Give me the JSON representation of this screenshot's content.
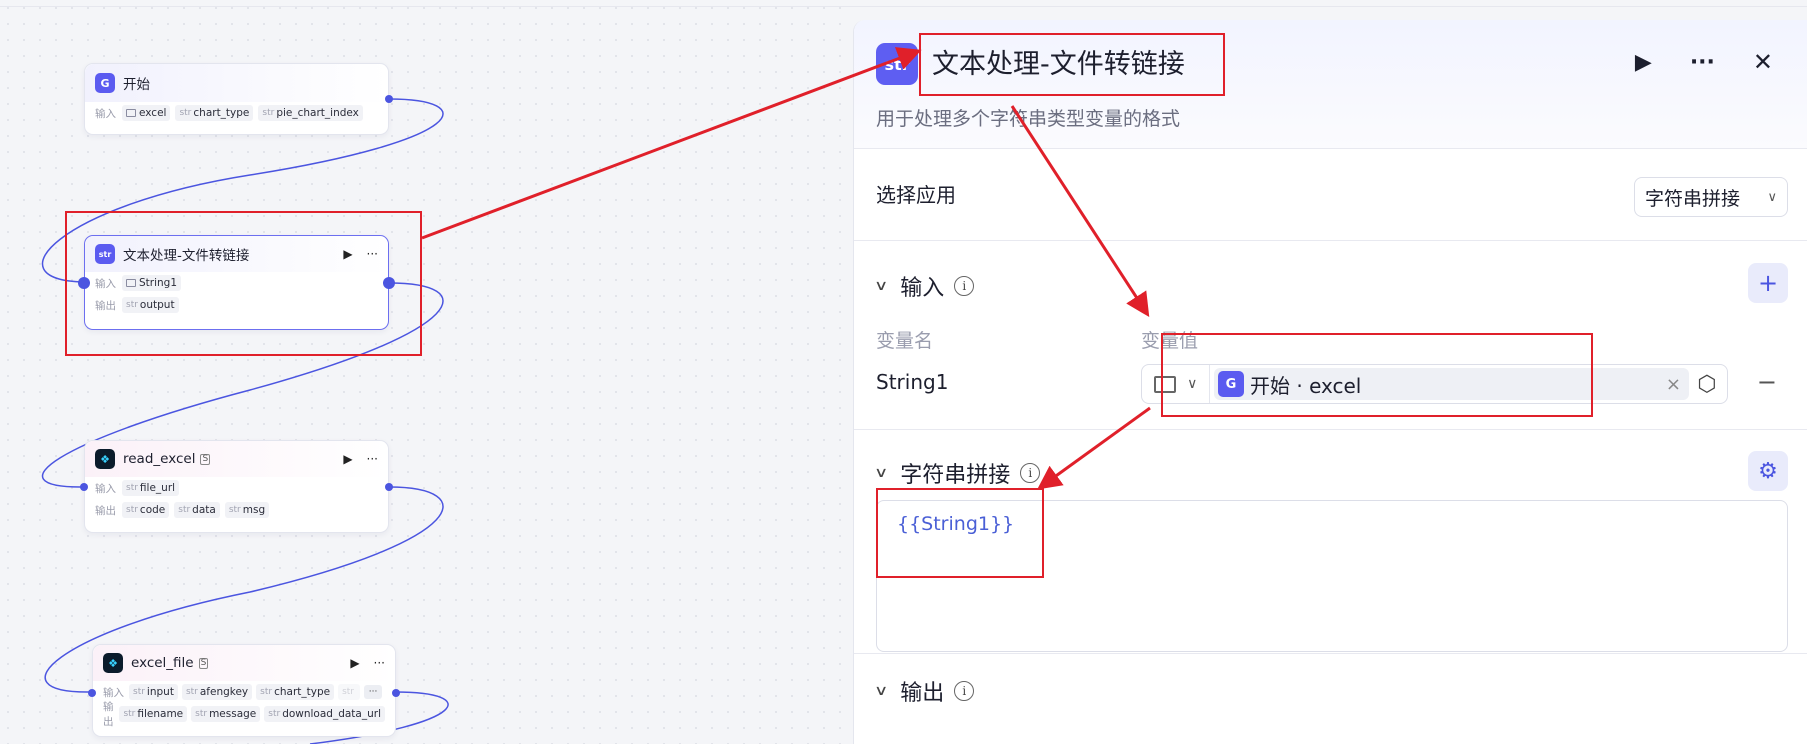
{
  "canvas": {
    "nodes": [
      {
        "id": "start",
        "title": "开始",
        "icon": "start-icon",
        "input_label": "输入",
        "inputs": [
          {
            "type": "",
            "name": "excel",
            "icon": "folder-icon"
          },
          {
            "type": "str",
            "name": "chart_type"
          },
          {
            "type": "str",
            "name": "pie_chart_index"
          }
        ]
      },
      {
        "id": "text-process",
        "title": "文本处理-文件转链接",
        "icon": "str-icon",
        "input_label": "输入",
        "output_label": "输出",
        "inputs": [
          {
            "type": "",
            "name": "String1",
            "icon": "folder-icon"
          }
        ],
        "outputs": [
          {
            "type": "str",
            "name": "output"
          }
        ]
      },
      {
        "id": "read-excel",
        "title": "read_excel",
        "icon": "plugin-icon",
        "badge": "S",
        "input_label": "输入",
        "output_label": "输出",
        "inputs": [
          {
            "type": "str",
            "name": "file_url"
          }
        ],
        "outputs": [
          {
            "type": "str",
            "name": "code"
          },
          {
            "type": "str",
            "name": "data"
          },
          {
            "type": "str",
            "name": "msg"
          }
        ]
      },
      {
        "id": "excel-file",
        "title": "excel_file",
        "icon": "plugin-icon",
        "badge": "S",
        "input_label": "输入",
        "output_label": "输出",
        "inputs": [
          {
            "type": "str",
            "name": "input"
          },
          {
            "type": "str",
            "name": "afengkey"
          },
          {
            "type": "str",
            "name": "chart_type"
          },
          {
            "type": "str",
            "name": ""
          }
        ],
        "more": "···",
        "outputs": [
          {
            "type": "str",
            "name": "filename"
          },
          {
            "type": "str",
            "name": "message"
          },
          {
            "type": "str",
            "name": "download_data_url"
          }
        ]
      }
    ],
    "node_icon_text": {
      "start": "G",
      "str": "str",
      "plugin": "❖"
    },
    "run_glyph": "▶",
    "more_glyph": "···"
  },
  "panel": {
    "title": "文本处理-文件转链接",
    "icon_text": "str",
    "description": "用于处理多个字符串类型变量的格式",
    "actions": {
      "run": "▶",
      "more": "···",
      "close": "✕"
    },
    "select_app": {
      "label": "选择应用",
      "selected": "字符串拼接",
      "chevron": "∨"
    },
    "input_section": {
      "title": "输入",
      "info": "i",
      "add": "+",
      "col_name": "变量名",
      "col_value": "变量值",
      "rows": [
        {
          "name": "String1",
          "ref_icon": "G",
          "ref_text": "开始 · excel",
          "clear": "×",
          "hex": "⬡",
          "remove": "−"
        }
      ]
    },
    "concat_section": {
      "title": "字符串拼接",
      "info": "i",
      "settings": "⚙",
      "template": "{{String1}}"
    },
    "output_section": {
      "title": "输出",
      "info": "i"
    }
  },
  "colors": {
    "accent": "#4b55e0",
    "annotation": "#e0202a"
  }
}
